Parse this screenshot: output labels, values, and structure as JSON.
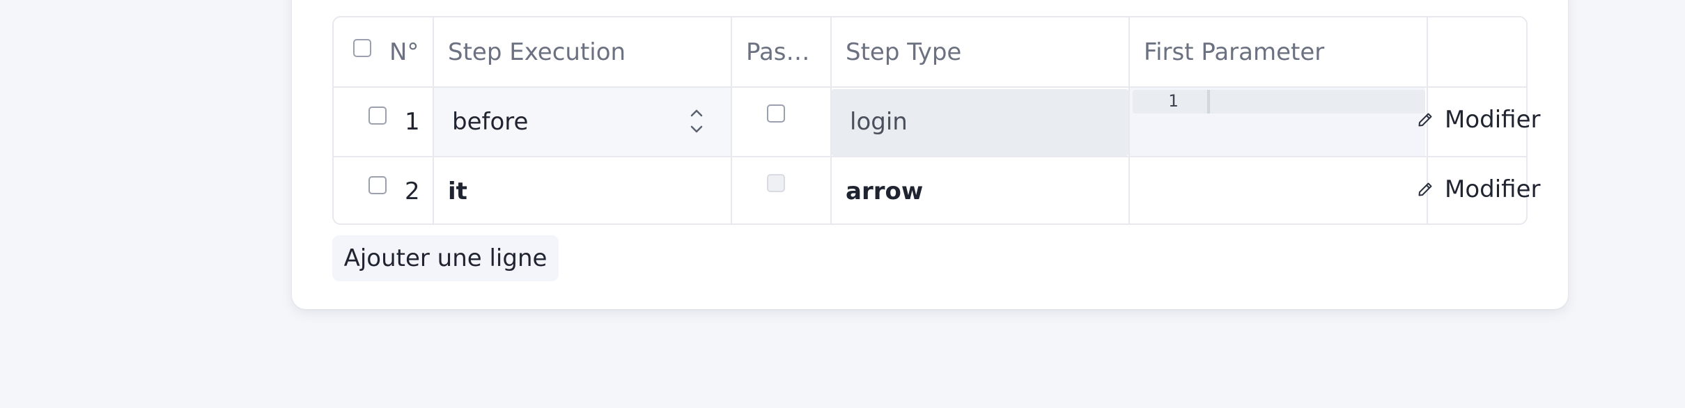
{
  "table": {
    "headers": {
      "number": "N°",
      "step_execution": "Step Execution",
      "pass": "Pas…",
      "step_type": "Step Type",
      "first_parameter": "First Parameter"
    },
    "rows": [
      {
        "number": "1",
        "step_execution": "before",
        "step_type": "login",
        "editor_line_number": "1",
        "action_label": "Modifier"
      },
      {
        "number": "2",
        "step_execution": "it",
        "step_type": "arrow",
        "action_label": "Modifier"
      }
    ]
  },
  "add_row_label": "Ajouter une ligne",
  "icons": {
    "select_arrows": "chevron-up-down-icon",
    "edit": "pencil-icon"
  },
  "colors": {
    "page_background": "#f5f6fa",
    "card_background": "#ffffff",
    "border": "#e7e9ee",
    "header_text": "#6b7180",
    "body_text": "#1f2430"
  }
}
